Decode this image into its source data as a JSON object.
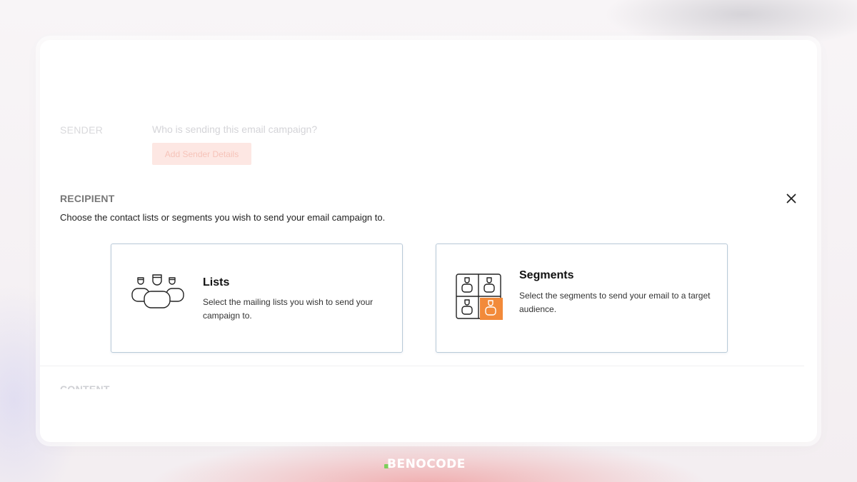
{
  "sender": {
    "label": "SENDER",
    "question": "Who is sending this email campaign?",
    "button_label": "Add Sender Details"
  },
  "recipient": {
    "title": "RECIPIENT",
    "description": "Choose the contact lists or segments you wish to send your email campaign to.",
    "close_icon": "close-icon",
    "options": [
      {
        "title": "Lists",
        "description": "Select the mailing lists you wish to send your campaign to.",
        "icon": "people-group-icon"
      },
      {
        "title": "Segments",
        "description": "Select the segments to send your email to a target audience.",
        "icon": "segments-grid-icon"
      }
    ]
  },
  "content": {
    "label": "CONTENT"
  },
  "branding": {
    "logo_text": "BENOCODE",
    "logo_icon": "benocode-logo-icon"
  },
  "colors": {
    "accent": "#f28a3a",
    "sender_button_bg": "#fde7e3",
    "card_border": "#b9cad8"
  }
}
